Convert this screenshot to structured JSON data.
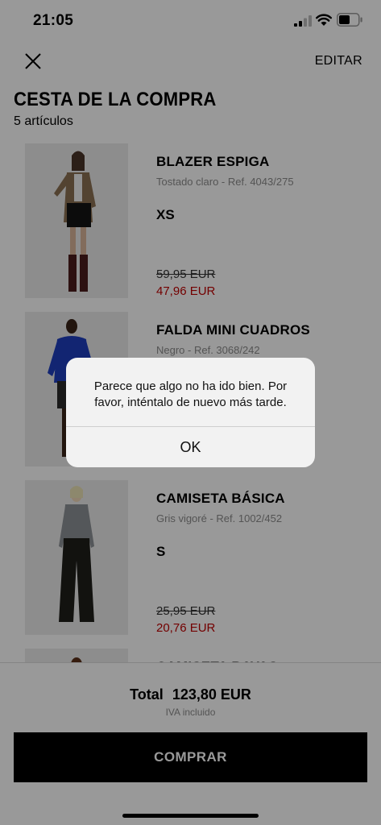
{
  "status_bar": {
    "time": "21:05"
  },
  "header": {
    "edit_label": "EDITAR"
  },
  "cart": {
    "title": "CESTA DE LA COMPRA",
    "count_label": "5 artículos",
    "items": [
      {
        "name": "BLAZER ESPIGA",
        "ref": "Tostado claro - Ref. 4043/275",
        "size": "XS",
        "old_price": "59,95 EUR",
        "new_price": "47,96 EUR"
      },
      {
        "name": "FALDA MINI CUADROS",
        "ref": "Negro - Ref. 3068/242",
        "size": "",
        "old_price": "",
        "new_price": ""
      },
      {
        "name": "CAMISETA BÁSICA",
        "ref": "Gris vigoré - Ref. 1002/452",
        "size": "S",
        "old_price": "25,95 EUR",
        "new_price": "20,76 EUR"
      },
      {
        "name": "CAMISETA RAYAS",
        "ref": "",
        "size": "",
        "old_price": "",
        "new_price": ""
      }
    ]
  },
  "footer": {
    "total_label": "Total",
    "total_value": "123,80 EUR",
    "vat_note": "IVA incluido",
    "buy_label": "COMPRAR"
  },
  "alert": {
    "message": "Parece que algo no ha ido bien. Por favor, inténtalo de nuevo más tarde.",
    "ok_label": "OK"
  },
  "colors": {
    "sale_red": "#c00000",
    "overlay": "rgba(0,0,0,0.4)",
    "button_black": "#000000"
  }
}
